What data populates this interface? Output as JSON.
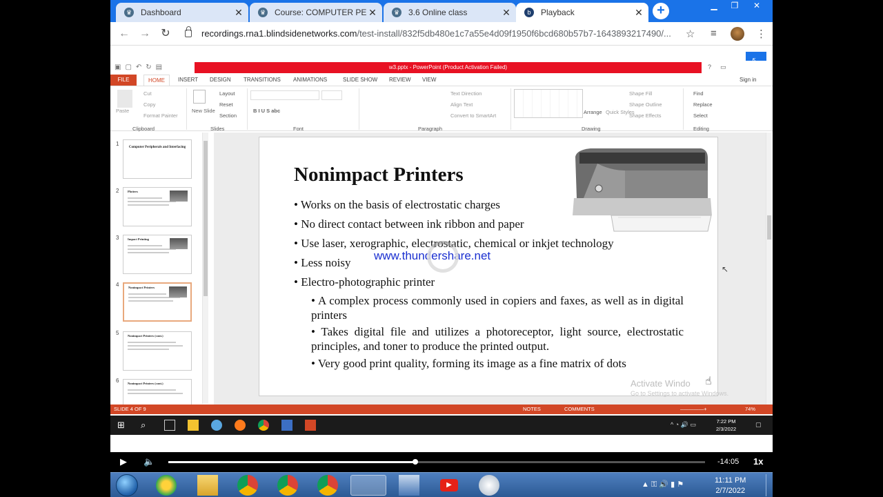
{
  "browser": {
    "tabs": [
      {
        "title": "Dashboard",
        "active": false
      },
      {
        "title": "Course: COMPUTER PERIPH",
        "active": false
      },
      {
        "title": "3.6 Online class",
        "active": false
      },
      {
        "title": "Playback",
        "active": true
      }
    ],
    "url_host": "recordings.rna1.blindsidenetworks.com",
    "url_path": "/test-install/832f5db480e1c7a55e4d09f1950f6bcd680b57b7-1643893217490/..."
  },
  "powerpoint": {
    "title_bar": "w3.pptx - PowerPoint (Product Activation Failed)",
    "menu": [
      "FILE",
      "HOME",
      "INSERT",
      "DESIGN",
      "TRANSITIONS",
      "ANIMATIONS",
      "SLIDE SHOW",
      "REVIEW",
      "VIEW"
    ],
    "sign_in": "Sign in",
    "ribbon": {
      "clipboard": {
        "label": "Clipboard",
        "paste": "Paste",
        "cut": "Cut",
        "copy": "Copy",
        "format_painter": "Format Painter"
      },
      "slides": {
        "label": "Slides",
        "new_slide": "New Slide",
        "layout": "Layout",
        "reset": "Reset",
        "section": "Section"
      },
      "font": {
        "label": "Font"
      },
      "paragraph": {
        "label": "Paragraph",
        "text_direction": "Text Direction",
        "align_text": "Align Text",
        "smartart": "Convert to SmartArt"
      },
      "drawing": {
        "label": "Drawing",
        "arrange": "Arrange",
        "quick_styles": "Quick Styles",
        "shape_fill": "Shape Fill",
        "shape_outline": "Shape Outline",
        "shape_effects": "Shape Effects"
      },
      "editing": {
        "label": "Editing",
        "find": "Find",
        "replace": "Replace",
        "select": "Select"
      }
    },
    "thumbnails": [
      {
        "num": "1",
        "title": "Computer Peripherals and Interfacing"
      },
      {
        "num": "2",
        "title": "Plotters"
      },
      {
        "num": "3",
        "title": "Impact Printing"
      },
      {
        "num": "4",
        "title": "Nonimpact Printers"
      },
      {
        "num": "5",
        "title": "Nonimpact Printers (cont.)"
      },
      {
        "num": "6",
        "title": "Nonimpact Printers (cont.)"
      }
    ],
    "slide": {
      "title": "Nonimpact Printers",
      "bullets": [
        "• Works on the basis of electrostatic charges",
        "• No direct contact between ink ribbon and paper",
        "• Use laser, xerographic, electrostatic, chemical or inkjet technology",
        "• Less noisy",
        "• Electro-photographic printer"
      ],
      "sub_bullets": [
        "• A complex process commonly used in copiers and faxes, as well as in digital printers",
        "• Takes digital file and utilizes a photoreceptor, light source, electrostatic principles, and toner to produce the printed output.",
        "• Very good print quality, forming its image as a fine matrix of dots"
      ]
    },
    "watermark": "www.thundershare.net",
    "activation_1": "Activate Windo",
    "activation_2": "Go to Settings to activate Windows.",
    "status": {
      "slide_of": "SLIDE 4 OF 9",
      "notes": "NOTES",
      "comments": "COMMENTS",
      "zoom": "74%"
    }
  },
  "win10_taskbar": {
    "time": "7:22 PM",
    "date": "2/3/2022"
  },
  "player": {
    "remaining": "-14:05",
    "speed": "1x",
    "progress": 0.46
  },
  "win7_taskbar": {
    "time": "11:11 PM",
    "date": "2/7/2022"
  }
}
